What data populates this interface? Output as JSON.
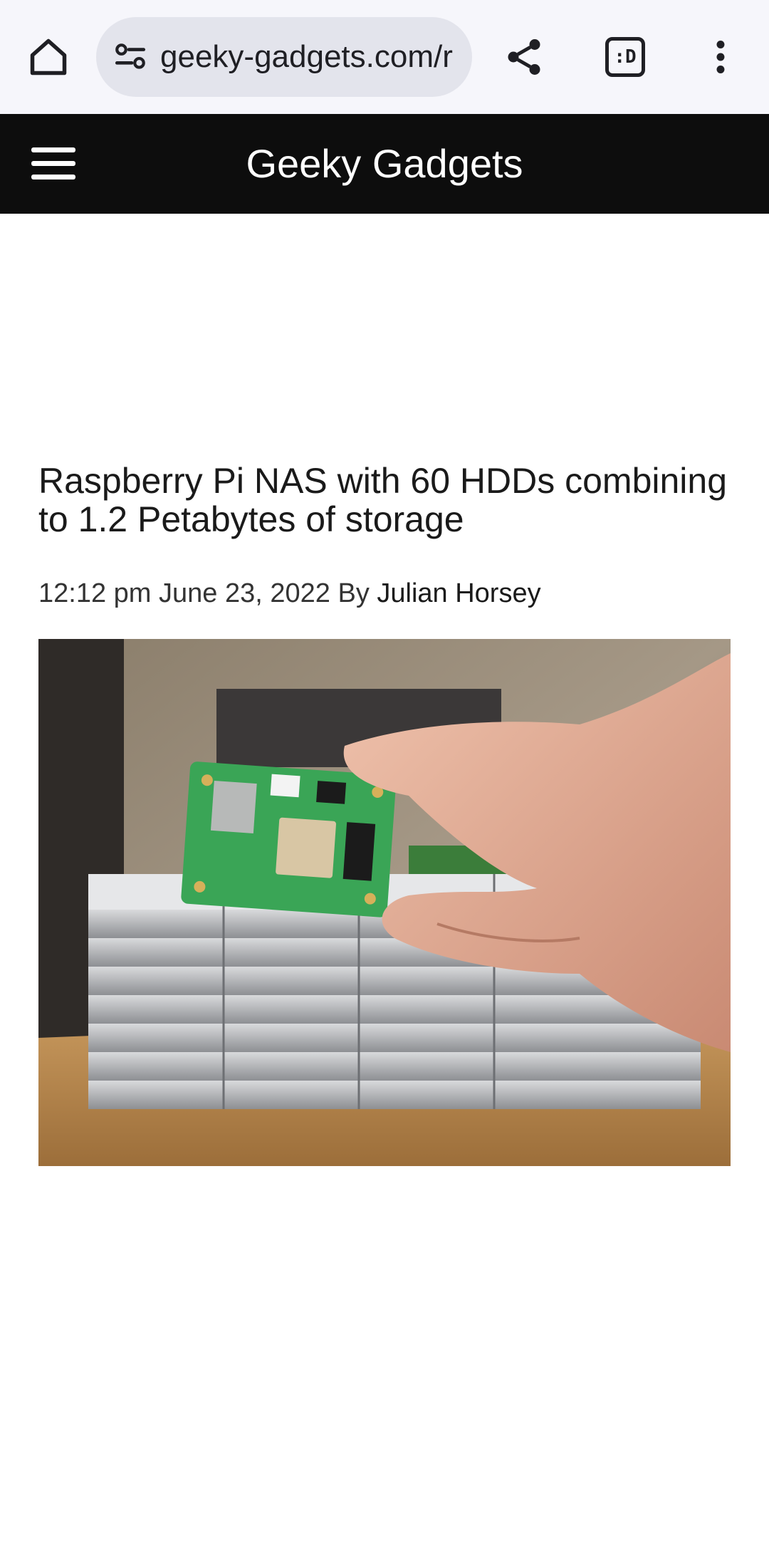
{
  "browser": {
    "url": "geeky-gadgets.com/r",
    "tabs_label": ":D",
    "icons": {
      "home": "home-icon",
      "site_info": "site-settings-icon",
      "share": "share-icon",
      "tabs": "tab-switcher-icon",
      "menu": "more-vert-icon"
    }
  },
  "site": {
    "title": "Geeky Gadgets",
    "menu_icon": "hamburger-menu-icon",
    "header_color": "#0d0d0d"
  },
  "article": {
    "title": "Raspberry Pi NAS with 60 HDDs combining to 1.2 Petabytes of storage",
    "time": "12:12 pm",
    "date": "June 23, 2022",
    "by": "By",
    "author": "Julian Horsey",
    "image_subject": "hand holding a Raspberry Pi Compute Module 4 in front of stacked hard drives"
  }
}
